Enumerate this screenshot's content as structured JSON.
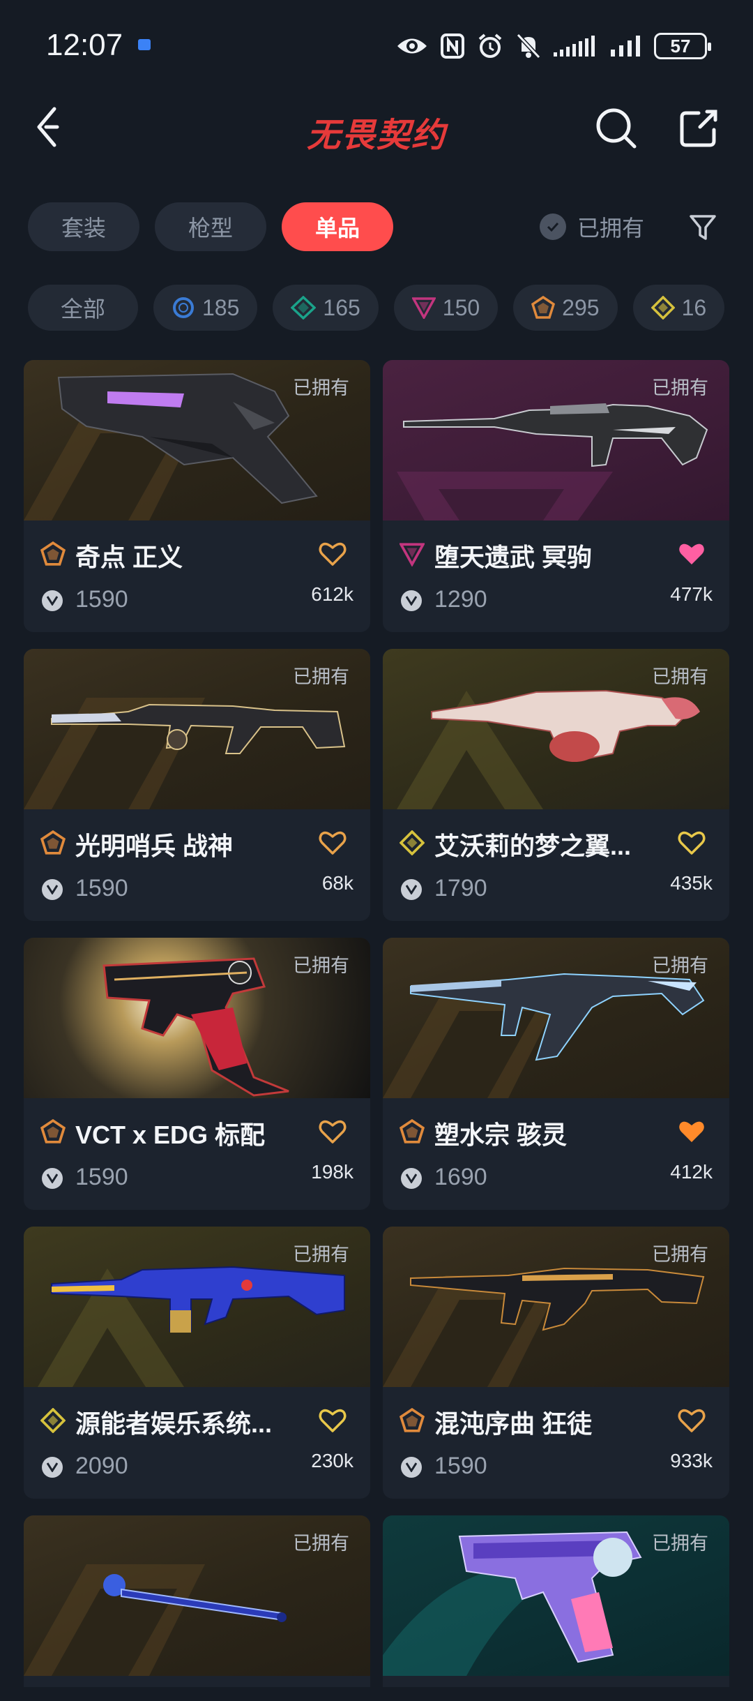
{
  "status_bar": {
    "time": "12:07",
    "battery": "57"
  },
  "header": {
    "title": "无畏契约"
  },
  "tabs": [
    {
      "label": "套装",
      "active": false
    },
    {
      "label": "枪型",
      "active": false
    },
    {
      "label": "单品",
      "active": true
    }
  ],
  "owned_filter": {
    "label": "已拥有"
  },
  "tiers": [
    {
      "label": "全部"
    },
    {
      "label": "185",
      "icon": "select-tier-icon",
      "color": "#3a7bd5"
    },
    {
      "label": "165",
      "icon": "deluxe-tier-icon",
      "color": "#1aa38a"
    },
    {
      "label": "150",
      "icon": "premium-tier-icon",
      "color": "#c2357e"
    },
    {
      "label": "295",
      "icon": "exclusive-tier-icon",
      "color": "#e08a3c"
    },
    {
      "label": "16",
      "icon": "ultra-tier-icon",
      "color": "#d6c23d"
    }
  ],
  "items": [
    {
      "name": "奇点 正义",
      "price": "1590",
      "likes": "612k",
      "owned": "已拥有",
      "tier": "exclusive",
      "favorited": false
    },
    {
      "name": "堕天遗武 冥驹",
      "price": "1290",
      "likes": "477k",
      "owned": "已拥有",
      "tier": "premium",
      "favorited": true
    },
    {
      "name": "光明哨兵 战神",
      "price": "1590",
      "likes": "68k",
      "owned": "已拥有",
      "tier": "exclusive",
      "favorited": false
    },
    {
      "name": "艾沃莉的梦之翼...",
      "price": "1790",
      "likes": "435k",
      "owned": "已拥有",
      "tier": "ultra",
      "favorited": false
    },
    {
      "name": "VCT x EDG 标配",
      "price": "1590",
      "likes": "198k",
      "owned": "已拥有",
      "tier": "exclusive",
      "favorited": false
    },
    {
      "name": "塑水宗 骇灵",
      "price": "1690",
      "likes": "412k",
      "owned": "已拥有",
      "tier": "exclusive",
      "favorited": true
    },
    {
      "name": "源能者娱乐系统...",
      "price": "2090",
      "likes": "230k",
      "owned": "已拥有",
      "tier": "ultra",
      "favorited": false
    },
    {
      "name": "混沌序曲 狂徒",
      "price": "1590",
      "likes": "933k",
      "owned": "已拥有",
      "tier": "exclusive",
      "favorited": false
    },
    {
      "owned": "已拥有"
    },
    {
      "owned": "已拥有"
    }
  ],
  "colors": {
    "accent": "#ff4d4d",
    "title_red": "#e63a3a",
    "heart_outline": "#e8a24a",
    "heart_pink": "#ff5fa2",
    "heart_orange": "#ff8a2a"
  }
}
